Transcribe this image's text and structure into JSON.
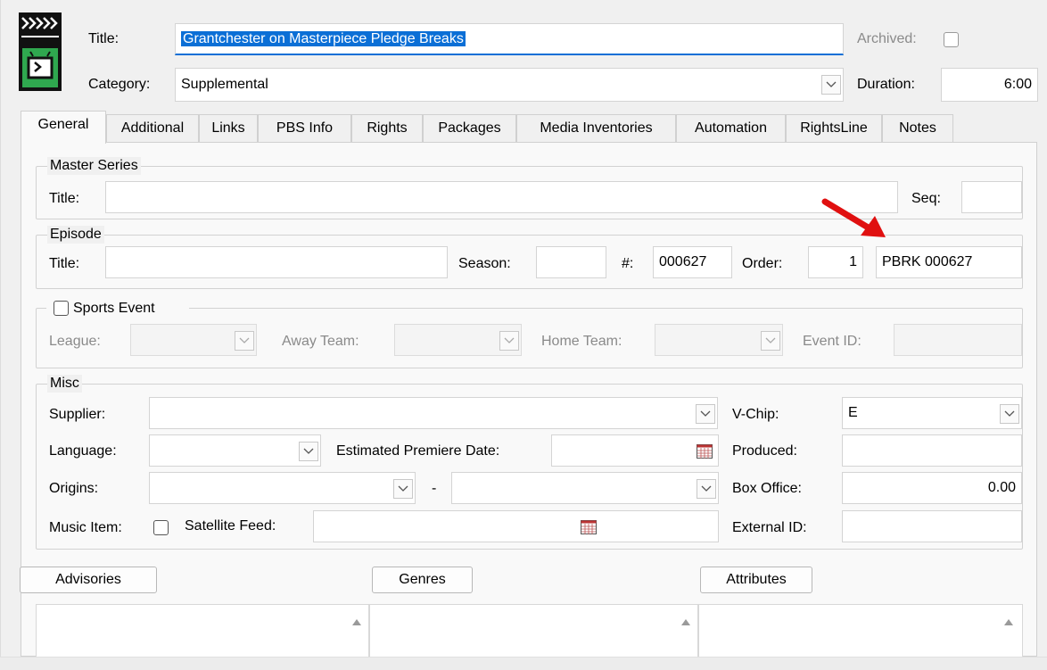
{
  "header": {
    "title_label": "Title:",
    "title_value": "Grantchester on Masterpiece Pledge Breaks",
    "archived_label": "Archived:",
    "category_label": "Category:",
    "category_value": "Supplemental",
    "duration_label": "Duration:",
    "duration_value": "6:00"
  },
  "tabs": [
    "General",
    "Additional",
    "Links",
    "PBS Info",
    "Rights",
    "Packages",
    "Media Inventories",
    "Automation",
    "RightsLine",
    "Notes"
  ],
  "active_tab": "General",
  "master_series": {
    "group_title": "Master Series",
    "title_label": "Title:",
    "title_value": "",
    "seq_label": "Seq:",
    "seq_value": ""
  },
  "episode": {
    "group_title": "Episode",
    "title_label": "Title:",
    "title_value": "",
    "season_label": "Season:",
    "season_value": "",
    "number_label": "#:",
    "number_value": "000627",
    "order_label": "Order:",
    "order_value": "1",
    "code_value": "PBRK 000627"
  },
  "sports": {
    "checkbox_label": "Sports Event",
    "league_label": "League:",
    "away_label": "Away Team:",
    "home_label": "Home Team:",
    "event_id_label": "Event ID:"
  },
  "misc": {
    "group_title": "Misc",
    "supplier_label": "Supplier:",
    "supplier_value": "",
    "vchip_label": "V-Chip:",
    "vchip_value": "E",
    "language_label": "Language:",
    "language_value": "",
    "premiere_label": "Estimated Premiere Date:",
    "premiere_value": "",
    "produced_label": "Produced:",
    "produced_value": "",
    "origins_label": "Origins:",
    "origins_dash": "-",
    "box_office_label": "Box Office:",
    "box_office_value": "0.00",
    "music_item_label": "Music Item:",
    "satellite_label": "Satellite Feed:",
    "satellite_value": "",
    "external_id_label": "External ID:",
    "external_id_value": ""
  },
  "buttons": {
    "advisories": "Advisories",
    "genres": "Genres",
    "attributes": "Attributes"
  },
  "icons": {
    "app_icon": "clapperboard-tv-icon",
    "arrow": "red-arrow-icon",
    "accent_selection": "#0b6fd6",
    "accent_green": "#2fa84f",
    "arrow_color": "#e01010"
  }
}
